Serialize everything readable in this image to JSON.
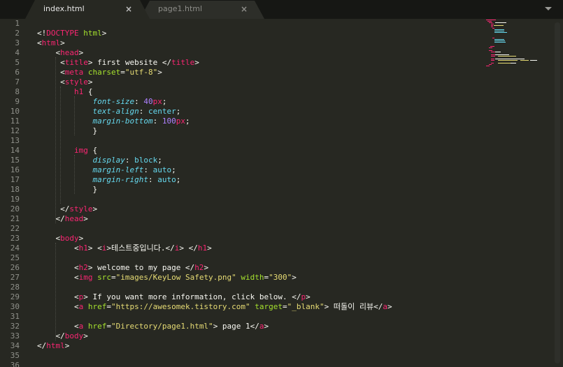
{
  "tabs": [
    {
      "label": "index.html",
      "close": "×",
      "active": true
    },
    {
      "label": "page1.html",
      "close": "×",
      "active": false
    }
  ],
  "tab_menu_icon": "triangle-down-icon",
  "colors": {
    "background": "#272822",
    "tag": "#f92672",
    "attribute": "#a6e22e",
    "string": "#e6db74",
    "css_property": "#66d9ef",
    "number": "#ae81ff",
    "text": "#f8f8f2",
    "line_number": "#8f908a"
  },
  "line_numbers": [
    "1",
    "2",
    "3",
    "4",
    "5",
    "6",
    "7",
    "8",
    "9",
    "10",
    "11",
    "12",
    "13",
    "14",
    "15",
    "16",
    "17",
    "18",
    "19",
    "20",
    "21",
    "22",
    "23",
    "24",
    "25",
    "26",
    "27",
    "28",
    "29",
    "30",
    "31",
    "32",
    "33",
    "34",
    "35",
    "36"
  ],
  "code_lines": [
    [],
    [
      {
        "t": "<!",
        "c": "t-text"
      },
      {
        "t": "DOCTYPE",
        "c": "t-doctype"
      },
      {
        "t": " ",
        "c": "t-text"
      },
      {
        "t": "html",
        "c": "t-attr"
      },
      {
        "t": ">",
        "c": "t-text"
      }
    ],
    [
      {
        "t": "<",
        "c": "t-text"
      },
      {
        "t": "html",
        "c": "t-tag"
      },
      {
        "t": ">",
        "c": "t-text"
      }
    ],
    [
      {
        "t": "    <",
        "c": "t-text"
      },
      {
        "t": "head",
        "c": "t-tag"
      },
      {
        "t": ">",
        "c": "t-text"
      }
    ],
    [
      {
        "t": "     <",
        "c": "t-text"
      },
      {
        "t": "title",
        "c": "t-tag"
      },
      {
        "t": "> first website </",
        "c": "t-text"
      },
      {
        "t": "title",
        "c": "t-tag"
      },
      {
        "t": ">",
        "c": "t-text"
      }
    ],
    [
      {
        "t": "     <",
        "c": "t-text"
      },
      {
        "t": "meta",
        "c": "t-tag"
      },
      {
        "t": " ",
        "c": "t-text"
      },
      {
        "t": "charset",
        "c": "t-attr"
      },
      {
        "t": "=",
        "c": "t-text"
      },
      {
        "t": "\"utf-8\"",
        "c": "t-str"
      },
      {
        "t": ">",
        "c": "t-text"
      }
    ],
    [
      {
        "t": "     <",
        "c": "t-text"
      },
      {
        "t": "style",
        "c": "t-tag"
      },
      {
        "t": ">",
        "c": "t-text"
      }
    ],
    [
      {
        "t": "        ",
        "c": "t-text"
      },
      {
        "t": "h1",
        "c": "t-tag"
      },
      {
        "t": " {",
        "c": "t-text"
      }
    ],
    [
      {
        "t": "            ",
        "c": "t-text"
      },
      {
        "t": "font-size",
        "c": "t-prop"
      },
      {
        "t": ": ",
        "c": "t-text"
      },
      {
        "t": "40",
        "c": "t-num"
      },
      {
        "t": "px",
        "c": "t-unit"
      },
      {
        "t": ";",
        "c": "t-text"
      }
    ],
    [
      {
        "t": "            ",
        "c": "t-text"
      },
      {
        "t": "text-align",
        "c": "t-prop"
      },
      {
        "t": ": ",
        "c": "t-text"
      },
      {
        "t": "center",
        "c": "t-val"
      },
      {
        "t": ";",
        "c": "t-text"
      }
    ],
    [
      {
        "t": "            ",
        "c": "t-text"
      },
      {
        "t": "margin-bottom",
        "c": "t-prop"
      },
      {
        "t": ": ",
        "c": "t-text"
      },
      {
        "t": "100",
        "c": "t-num"
      },
      {
        "t": "px",
        "c": "t-unit"
      },
      {
        "t": ";",
        "c": "t-text"
      }
    ],
    [
      {
        "t": "            }",
        "c": "t-text"
      }
    ],
    [],
    [
      {
        "t": "        ",
        "c": "t-text"
      },
      {
        "t": "img",
        "c": "t-tag"
      },
      {
        "t": " {",
        "c": "t-text"
      }
    ],
    [
      {
        "t": "            ",
        "c": "t-text"
      },
      {
        "t": "display",
        "c": "t-prop"
      },
      {
        "t": ": ",
        "c": "t-text"
      },
      {
        "t": "block",
        "c": "t-val"
      },
      {
        "t": ";",
        "c": "t-text"
      }
    ],
    [
      {
        "t": "            ",
        "c": "t-text"
      },
      {
        "t": "margin-left",
        "c": "t-prop"
      },
      {
        "t": ": ",
        "c": "t-text"
      },
      {
        "t": "auto",
        "c": "t-val"
      },
      {
        "t": ";",
        "c": "t-text"
      }
    ],
    [
      {
        "t": "            ",
        "c": "t-text"
      },
      {
        "t": "margin-right",
        "c": "t-prop"
      },
      {
        "t": ": ",
        "c": "t-text"
      },
      {
        "t": "auto",
        "c": "t-val"
      },
      {
        "t": ";",
        "c": "t-text"
      }
    ],
    [
      {
        "t": "            }",
        "c": "t-text"
      }
    ],
    [],
    [
      {
        "t": "     </",
        "c": "t-text"
      },
      {
        "t": "style",
        "c": "t-tag"
      },
      {
        "t": ">",
        "c": "t-text"
      }
    ],
    [
      {
        "t": "    </",
        "c": "t-text"
      },
      {
        "t": "head",
        "c": "t-tag"
      },
      {
        "t": ">",
        "c": "t-text"
      }
    ],
    [],
    [
      {
        "t": "    <",
        "c": "t-text"
      },
      {
        "t": "body",
        "c": "t-tag"
      },
      {
        "t": ">",
        "c": "t-text"
      }
    ],
    [
      {
        "t": "        <",
        "c": "t-text"
      },
      {
        "t": "h1",
        "c": "t-tag"
      },
      {
        "t": "> <",
        "c": "t-text"
      },
      {
        "t": "i",
        "c": "t-tag"
      },
      {
        "t": ">테스트중입니다.</",
        "c": "t-text"
      },
      {
        "t": "i",
        "c": "t-tag"
      },
      {
        "t": "> </",
        "c": "t-text"
      },
      {
        "t": "h1",
        "c": "t-tag"
      },
      {
        "t": ">",
        "c": "t-text"
      }
    ],
    [],
    [
      {
        "t": "        <",
        "c": "t-text"
      },
      {
        "t": "h2",
        "c": "t-tag"
      },
      {
        "t": "> welcome to my page </",
        "c": "t-text"
      },
      {
        "t": "h2",
        "c": "t-tag"
      },
      {
        "t": ">",
        "c": "t-text"
      }
    ],
    [
      {
        "t": "        <",
        "c": "t-text"
      },
      {
        "t": "img",
        "c": "t-tag"
      },
      {
        "t": " ",
        "c": "t-text"
      },
      {
        "t": "src",
        "c": "t-attr"
      },
      {
        "t": "=",
        "c": "t-text"
      },
      {
        "t": "\"images/KeyLow Safety.png\"",
        "c": "t-str"
      },
      {
        "t": " ",
        "c": "t-text"
      },
      {
        "t": "width",
        "c": "t-attr"
      },
      {
        "t": "=",
        "c": "t-text"
      },
      {
        "t": "\"300\"",
        "c": "t-str"
      },
      {
        "t": ">",
        "c": "t-text"
      }
    ],
    [],
    [
      {
        "t": "        <",
        "c": "t-text"
      },
      {
        "t": "p",
        "c": "t-tag"
      },
      {
        "t": "> If you want more information, click below. </",
        "c": "t-text"
      },
      {
        "t": "p",
        "c": "t-tag"
      },
      {
        "t": ">",
        "c": "t-text"
      }
    ],
    [
      {
        "t": "        <",
        "c": "t-text"
      },
      {
        "t": "a",
        "c": "t-tag"
      },
      {
        "t": " ",
        "c": "t-text"
      },
      {
        "t": "href",
        "c": "t-attr"
      },
      {
        "t": "=",
        "c": "t-text"
      },
      {
        "t": "\"https://awesomek.tistory.com\"",
        "c": "t-str"
      },
      {
        "t": " ",
        "c": "t-text"
      },
      {
        "t": "target",
        "c": "t-attr"
      },
      {
        "t": "=",
        "c": "t-text"
      },
      {
        "t": "\"_blank\"",
        "c": "t-str"
      },
      {
        "t": "> 떠돌이 리뷰</",
        "c": "t-text"
      },
      {
        "t": "a",
        "c": "t-tag"
      },
      {
        "t": ">",
        "c": "t-text"
      }
    ],
    [],
    [
      {
        "t": "        <",
        "c": "t-text"
      },
      {
        "t": "a",
        "c": "t-tag"
      },
      {
        "t": " ",
        "c": "t-text"
      },
      {
        "t": "href",
        "c": "t-attr"
      },
      {
        "t": "=",
        "c": "t-text"
      },
      {
        "t": "\"Directory/page1.html\"",
        "c": "t-str"
      },
      {
        "t": "> page 1</",
        "c": "t-text"
      },
      {
        "t": "a",
        "c": "t-tag"
      },
      {
        "t": ">",
        "c": "t-text"
      }
    ],
    [
      {
        "t": "    </",
        "c": "t-text"
      },
      {
        "t": "body",
        "c": "t-tag"
      },
      {
        "t": ">",
        "c": "t-text"
      }
    ],
    [
      {
        "t": "</",
        "c": "t-text"
      },
      {
        "t": "html",
        "c": "t-tag"
      },
      {
        "t": ">",
        "c": "t-text"
      }
    ],
    [],
    []
  ]
}
